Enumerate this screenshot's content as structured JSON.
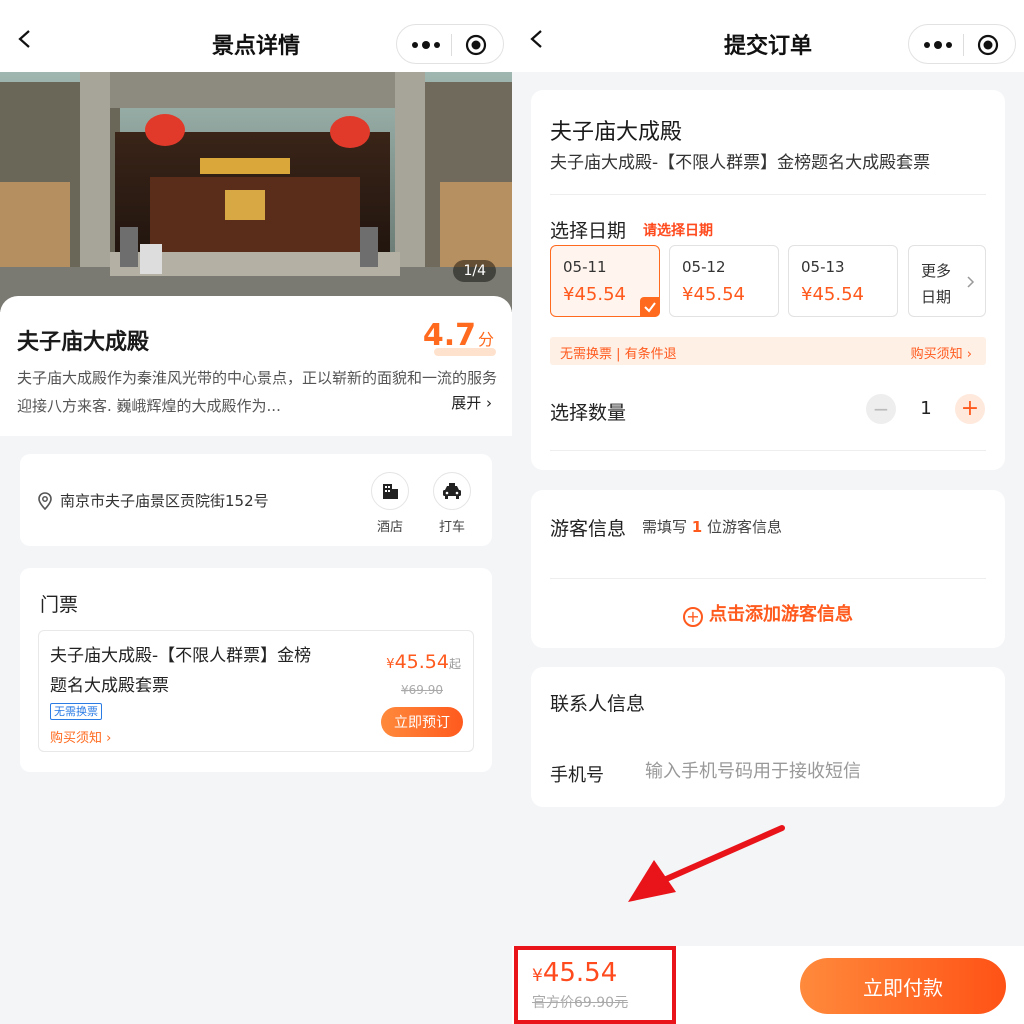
{
  "left_screen": {
    "nav_title": "景点详情",
    "image_counter": "1/4",
    "spot_name": "夫子庙大成殿",
    "rating_value": "4.7",
    "rating_unit": "分",
    "description": "夫子庙大成殿作为秦淮风光带的中心景点，正以崭新的面貌和一流的服务迎接八方来客. 巍峨辉煌的大成殿作为...",
    "expand_label": "展开 ›",
    "address": "南京市夫子庙景区贡院街152号",
    "hotel_label": "酒店",
    "taxi_label": "打车",
    "ticket_section_title": "门票",
    "ticket": {
      "title": "夫子庙大成殿-【不限人群票】金榜题名大成殿套票",
      "tag": "无需换票",
      "buy_note": "购买须知 ›",
      "currency": "¥",
      "price": "45.54",
      "price_suffix": "起",
      "original_price": "¥69.90",
      "book_button": "立即预订"
    }
  },
  "right_screen": {
    "nav_title": "提交订单",
    "order_name": "夫子庙大成殿",
    "order_sub": "夫子庙大成殿-【不限人群票】金榜题名大成殿套票",
    "date_title": "选择日期",
    "date_hint": "请选择日期",
    "dates": [
      {
        "date": "05-11",
        "price": "¥45.54",
        "selected": true
      },
      {
        "date": "05-12",
        "price": "¥45.54",
        "selected": false
      },
      {
        "date": "05-13",
        "price": "¥45.54",
        "selected": false
      }
    ],
    "more_dates_label": "更多日期",
    "notice_left": "无需换票 | 有条件退",
    "notice_right": "购买须知 ›",
    "quantity_title": "选择数量",
    "quantity_value": "1",
    "tourist_title": "游客信息",
    "tourist_hint_prefix": "需填写",
    "tourist_hint_count": "1",
    "tourist_hint_suffix": "位游客信息",
    "add_tourist_label": "点击添加游客信息",
    "contact_title": "联系人信息",
    "phone_label": "手机号",
    "phone_placeholder": "输入手机号码用于接收短信",
    "total_currency": "¥",
    "total_price": "45.54",
    "official_price": "官方价69.90元",
    "pay_button": "立即付款"
  },
  "colors": {
    "accent": "#ff5a1e",
    "highlight_box": "#e8141a",
    "tag_blue": "#2b7be5"
  },
  "icons": [
    "back-icon",
    "more-dots-icon",
    "capsule-target-icon",
    "location-pin-icon",
    "hotel-icon",
    "taxi-icon",
    "chevron-right-icon",
    "check-icon",
    "minus-icon",
    "plus-icon",
    "plus-circle-icon",
    "red-arrow-annotation"
  ]
}
